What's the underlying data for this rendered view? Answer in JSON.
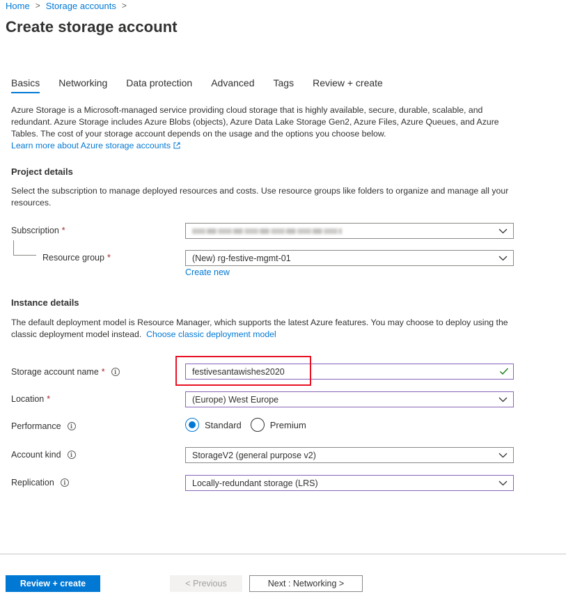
{
  "breadcrumb": {
    "home": "Home",
    "storage_accounts": "Storage accounts"
  },
  "page_title": "Create storage account",
  "tabs": [
    {
      "label": "Basics",
      "active": true
    },
    {
      "label": "Networking"
    },
    {
      "label": "Data protection"
    },
    {
      "label": "Advanced"
    },
    {
      "label": "Tags"
    },
    {
      "label": "Review + create"
    }
  ],
  "intro": {
    "text": "Azure Storage is a Microsoft-managed service providing cloud storage that is highly available, secure, durable, scalable, and redundant. Azure Storage includes Azure Blobs (objects), Azure Data Lake Storage Gen2, Azure Files, Azure Queues, and Azure Tables. The cost of your storage account depends on the usage and the options you choose below.",
    "learn_more": "Learn more about Azure storage accounts"
  },
  "project_details": {
    "title": "Project details",
    "description": "Select the subscription to manage deployed resources and costs. Use resource groups like folders to organize and manage all your resources.",
    "subscription_label": "Subscription",
    "resource_group_label": "Resource group",
    "resource_group_value": "(New) rg-festive-mgmt-01",
    "create_new": "Create new"
  },
  "instance_details": {
    "title": "Instance details",
    "description": "The default deployment model is Resource Manager, which supports the latest Azure features. You may choose to deploy using the classic deployment model instead.",
    "classic_link": "Choose classic deployment model",
    "storage_name_label": "Storage account name",
    "storage_name_value": "festivesantawishes2020",
    "location_label": "Location",
    "location_value": "(Europe) West Europe",
    "performance_label": "Performance",
    "performance_options": [
      "Standard",
      "Premium"
    ],
    "performance_selected": "Standard",
    "account_kind_label": "Account kind",
    "account_kind_value": "StorageV2 (general purpose v2)",
    "replication_label": "Replication",
    "replication_value": "Locally-redundant storage (LRS)"
  },
  "footer": {
    "review_create": "Review + create",
    "previous": "< Previous",
    "next": "Next : Networking >"
  },
  "colors": {
    "accent": "#0078d4",
    "required": "#a4262c",
    "valid": "#107c10",
    "highlight": "#e81123",
    "focus_border": "#8764b8"
  }
}
